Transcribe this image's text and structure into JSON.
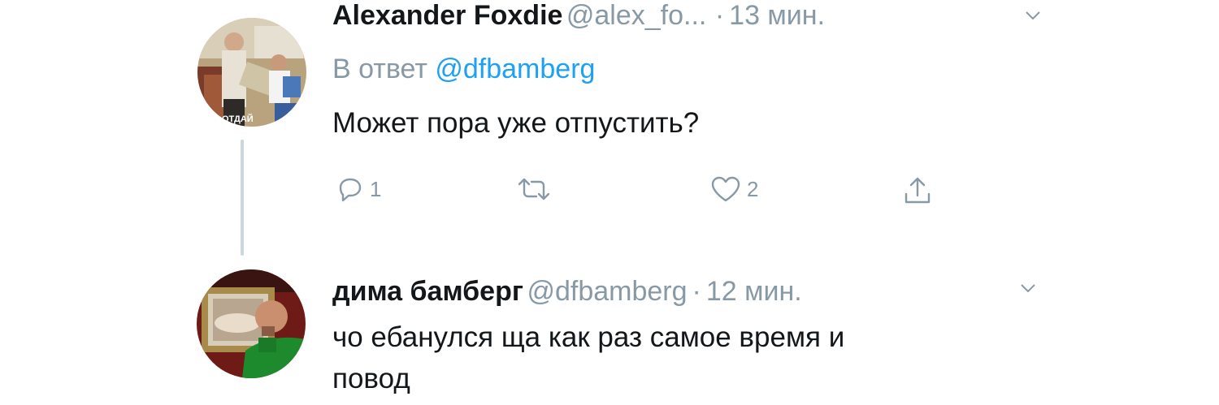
{
  "tweets": [
    {
      "name": "Alexander Foxdie",
      "handle": "@alex_fo...",
      "separator": "·",
      "time": "13 мин.",
      "reply_prefix": "В ответ",
      "reply_mention": "@dfbamberg",
      "text": "Может пора уже отпустить?",
      "avatar_caption": "ОТДАЙ",
      "actions": {
        "reply_count": "1",
        "retweet_count": "",
        "like_count": "2"
      }
    },
    {
      "name": "дима бамберг",
      "handle": "@dfbamberg",
      "separator": "·",
      "time": "12 мин.",
      "text_line1": "чо ебанулся ща как раз самое время и",
      "text_line2": "повод"
    }
  ],
  "colors": {
    "muted": "#8899a6",
    "link": "#1da1f2",
    "text": "#14171a",
    "thread_line": "#ccd6dd"
  },
  "icons": [
    "reply-icon",
    "retweet-icon",
    "like-icon",
    "share-icon",
    "chevron-down-icon"
  ]
}
